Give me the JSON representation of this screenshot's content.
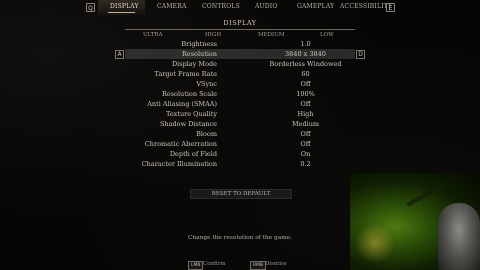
{
  "nav": {
    "left_key": "Q",
    "right_key": "E",
    "tabs": [
      "DISPLAY",
      "CAMERA",
      "CONTROLS",
      "AUDIO",
      "GAMEPLAY",
      "ACCESSIBILITY"
    ],
    "active_tab": "DISPLAY"
  },
  "section_title": "DISPLAY",
  "presets": [
    "ULTRA",
    "HIGH",
    "MEDIUM",
    "LOW"
  ],
  "side_keys": {
    "left": "A",
    "right": "D"
  },
  "settings": [
    {
      "label": "Brightness",
      "value": "1.0"
    },
    {
      "label": "Resolution",
      "value": "3840 x 3840"
    },
    {
      "label": "Display Mode",
      "value": "Borderless Windowed"
    },
    {
      "label": "Target Frame Rate",
      "value": "60"
    },
    {
      "label": "VSync",
      "value": "Off"
    },
    {
      "label": "Resolution Scale",
      "value": "100%"
    },
    {
      "label": "Anti Aliasing (SMAA)",
      "value": "Off"
    },
    {
      "label": "Texture Quality",
      "value": "High"
    },
    {
      "label": "Shadow Distance",
      "value": "Medium"
    },
    {
      "label": "Bloom",
      "value": "Off"
    },
    {
      "label": "Chromatic Aberration",
      "value": "Off"
    },
    {
      "label": "Depth of Field",
      "value": "On"
    },
    {
      "label": "Character Illumination",
      "value": "0.2"
    }
  ],
  "selected_setting": "Resolution",
  "reset_label": "RESET TO DEFAULT",
  "description": "Change the resolution of the game.",
  "bottom": {
    "confirm_key": "LMB",
    "confirm_label": "Confirm",
    "dismiss_key": "RMB",
    "dismiss_label": "Dismiss"
  },
  "colors": {
    "accent": "#c9b48a",
    "selected_row": "#4a4a4a",
    "background": "#050505"
  }
}
